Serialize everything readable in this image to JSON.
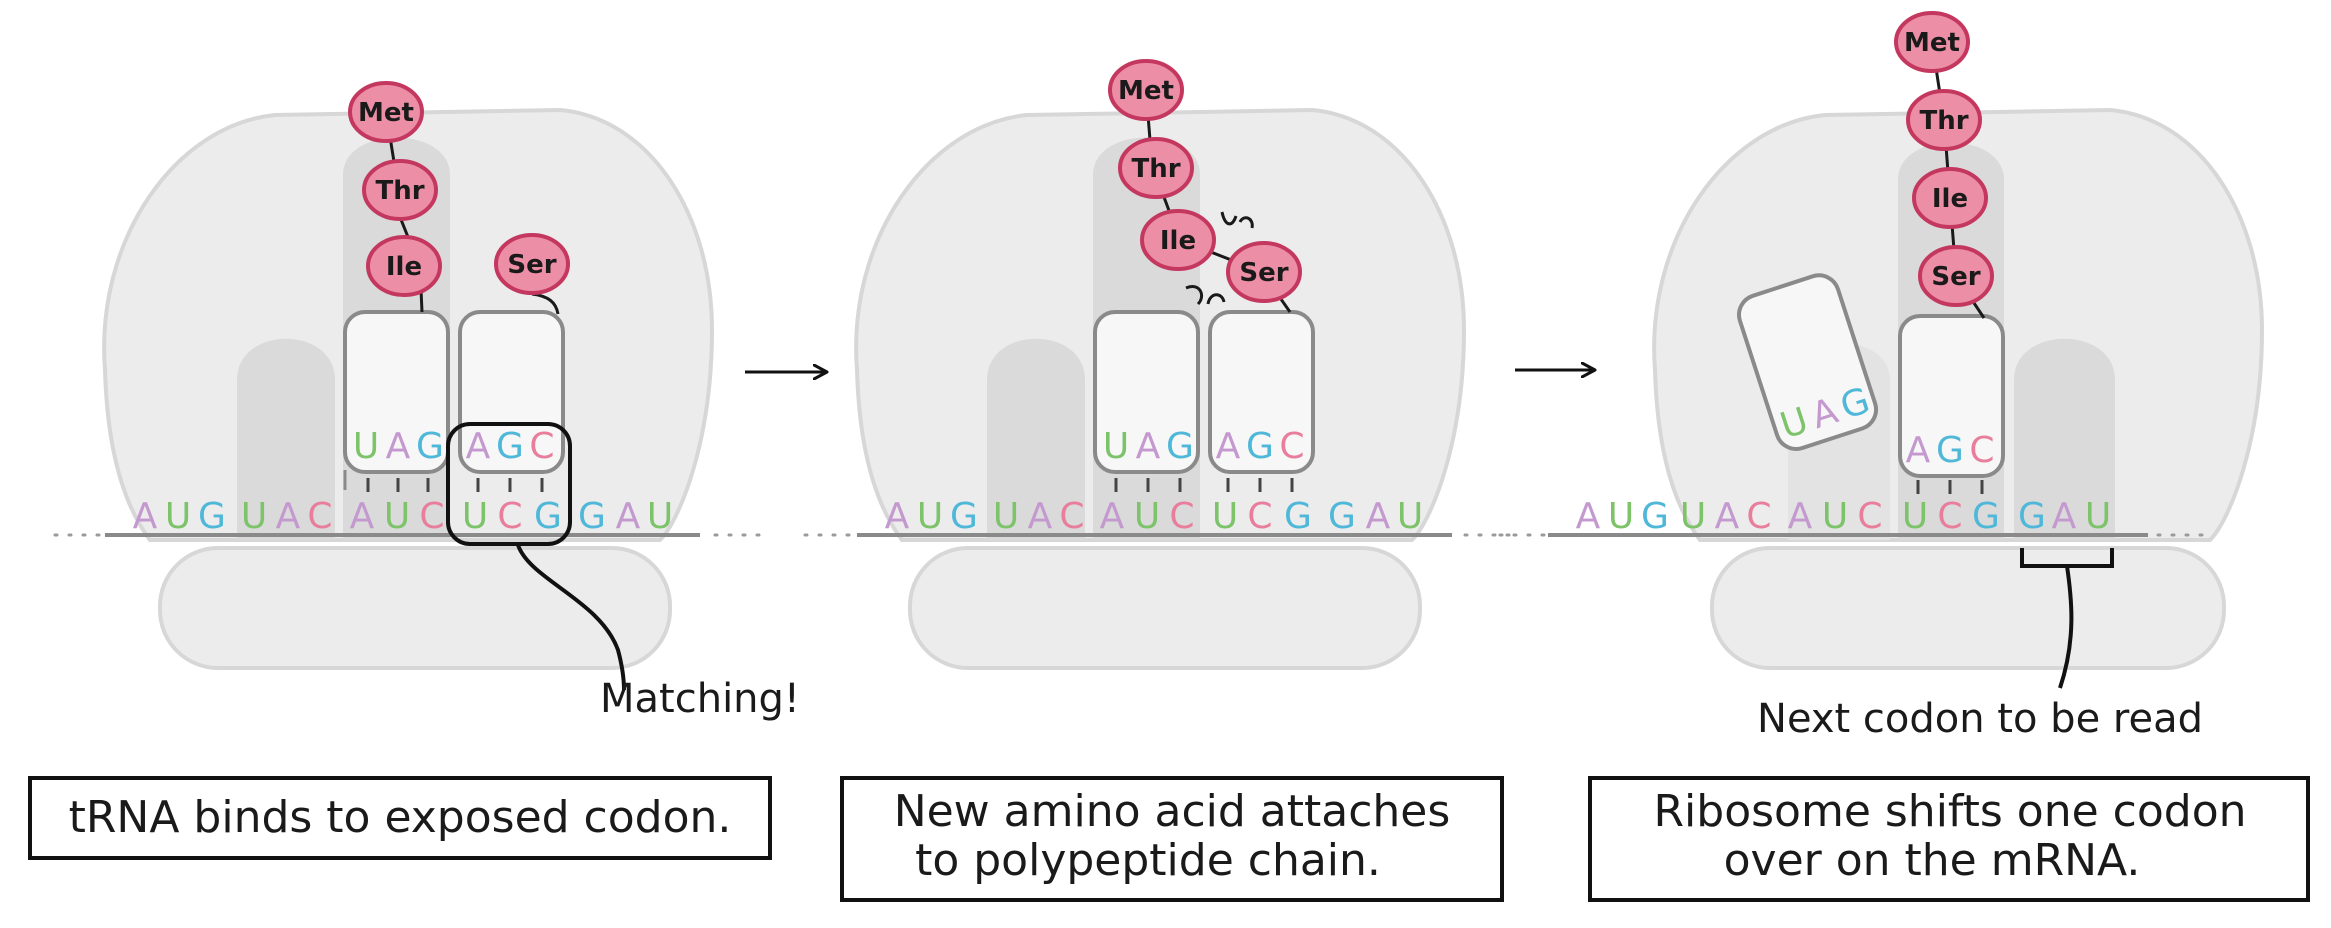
{
  "colors": {
    "A": "#c499cf",
    "U": "#7cc36a",
    "G": "#4fb8d9",
    "C": "#e87e9c",
    "amino_fill": "#ec8fa6",
    "amino_stroke": "#c4385f",
    "ribosome": "#ececec",
    "ribosome_stroke": "#d7d7d7",
    "channel": "#dadada",
    "trna_fill": "#f7f7f7",
    "trna_stroke": "#8a8a8a"
  },
  "mrna": "AUGUACAUCUCGGAU",
  "panels": [
    {
      "amino_acids_chain": [
        "Met",
        "Thr",
        "Ile"
      ],
      "amino_acid_new": "Ser",
      "trna_left_anticodon": "UAG",
      "trna_right_anticodon": "AGC",
      "annotation": "Matching!",
      "caption_lines": [
        "tRNA binds to  exposed codon."
      ]
    },
    {
      "amino_acids_chain": [
        "Met",
        "Thr",
        "Ile",
        "Ser"
      ],
      "trna_left_anticodon": "UAG",
      "trna_right_anticodon": "AGC",
      "caption_lines": [
        "New  amino  acid  attaches",
        "to  polypeptide  chain."
      ]
    },
    {
      "amino_acids_chain": [
        "Met",
        "Thr",
        "Ile",
        "Ser"
      ],
      "trna_exiting_anticodon": "UAG",
      "trna_anticodon": "AGC",
      "annotation": "Next codon to be read",
      "caption_lines": [
        "Ribosome  shifts  one  codon",
        "over  on  the  mRNA."
      ]
    }
  ],
  "arrows": [
    "→",
    "→"
  ]
}
